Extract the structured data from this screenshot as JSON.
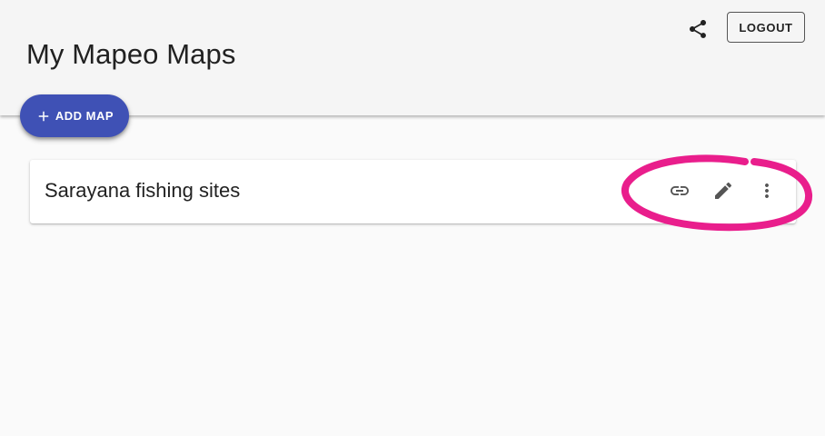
{
  "header": {
    "title": "My Mapeo Maps",
    "share_icon": "share-icon",
    "logout_label": "LOGOUT"
  },
  "actions": {
    "add_map_label": "ADD MAP",
    "add_icon": "plus-icon"
  },
  "maps": [
    {
      "name": "Sarayana fishing sites",
      "icons": [
        "link-icon",
        "pencil-icon",
        "more-vertical-icon"
      ]
    }
  ],
  "colors": {
    "header_bg": "#f5f5f5",
    "page_bg": "#fafafa",
    "primary": "#3f51b5",
    "highlight": "#e91e8c",
    "icon": "#555555"
  }
}
